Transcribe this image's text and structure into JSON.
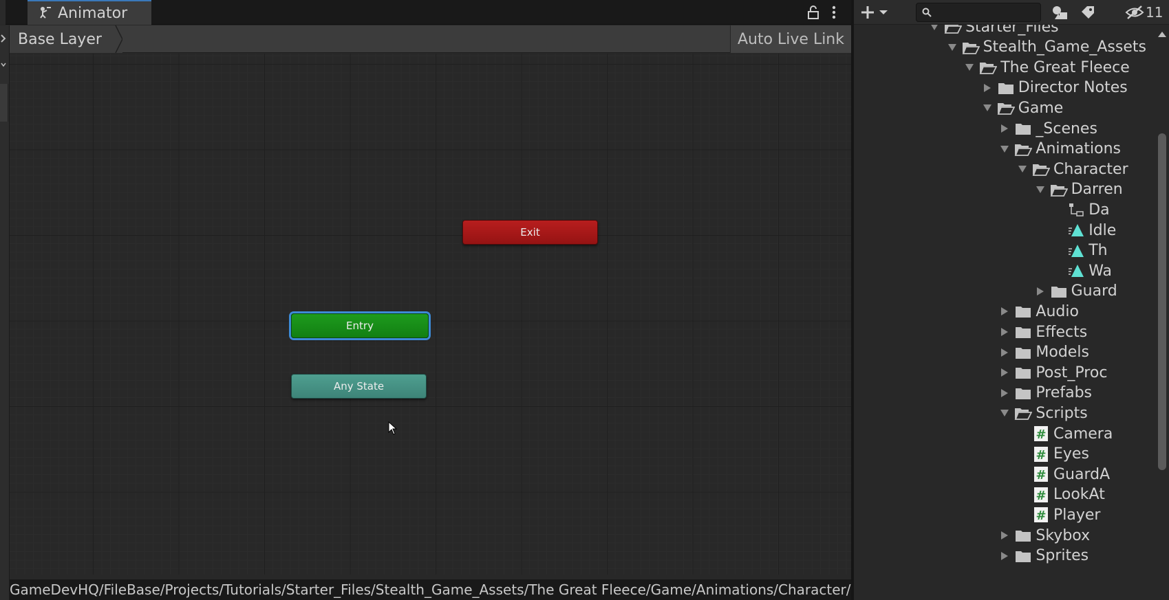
{
  "animator": {
    "tab_title": "Animator",
    "layer_name": "Base Layer",
    "live_link_label": "Auto Live Link",
    "states": {
      "exit": "Exit",
      "entry": "Entry",
      "any_state": "Any State"
    },
    "colors": {
      "exit": "#b81e1e",
      "entry": "#1e9b1e",
      "any_state": "#4f9f90",
      "selection": "#3d8ad6",
      "tab_accent": "#3a79bb"
    },
    "asset_path": "GameDevHQ/FileBase/Projects/Tutorials/Starter_Files/Stealth_Game_Assets/The Great Fleece/Game/Animations/Character/Da"
  },
  "project": {
    "search": {
      "value": "",
      "placeholder": ""
    },
    "hidden_packages_count": "11",
    "tree": [
      {
        "label": "Starter_Files",
        "depth": 0,
        "expanded": true,
        "icon": "folder-open-icon"
      },
      {
        "label": "Stealth_Game_Assets",
        "depth": 1,
        "expanded": true,
        "icon": "folder-open-icon"
      },
      {
        "label": "The Great Fleece",
        "depth": 2,
        "expanded": true,
        "icon": "folder-open-icon"
      },
      {
        "label": "Director Notes",
        "depth": 3,
        "expanded": false,
        "icon": "folder-icon"
      },
      {
        "label": "Game",
        "depth": 3,
        "expanded": true,
        "icon": "folder-open-icon"
      },
      {
        "label": "_Scenes",
        "depth": 4,
        "expanded": false,
        "icon": "folder-icon"
      },
      {
        "label": "Animations",
        "depth": 4,
        "expanded": true,
        "icon": "folder-open-icon"
      },
      {
        "label": "Character",
        "depth": 5,
        "expanded": true,
        "icon": "folder-open-icon"
      },
      {
        "label": "Darren",
        "depth": 6,
        "expanded": true,
        "icon": "folder-open-icon"
      },
      {
        "label": "Da",
        "depth": 7,
        "expanded": null,
        "icon": "animator-controller-icon"
      },
      {
        "label": "Idle",
        "depth": 7,
        "expanded": null,
        "icon": "animation-clip-icon"
      },
      {
        "label": "Th",
        "depth": 7,
        "expanded": null,
        "icon": "animation-clip-icon"
      },
      {
        "label": "Wa",
        "depth": 7,
        "expanded": null,
        "icon": "animation-clip-icon"
      },
      {
        "label": "Guard",
        "depth": 6,
        "expanded": false,
        "icon": "folder-icon"
      },
      {
        "label": "Audio",
        "depth": 4,
        "expanded": false,
        "icon": "folder-icon"
      },
      {
        "label": "Effects",
        "depth": 4,
        "expanded": false,
        "icon": "folder-icon"
      },
      {
        "label": "Models",
        "depth": 4,
        "expanded": false,
        "icon": "folder-icon"
      },
      {
        "label": "Post_Proc",
        "depth": 4,
        "expanded": false,
        "icon": "folder-icon"
      },
      {
        "label": "Prefabs",
        "depth": 4,
        "expanded": false,
        "icon": "folder-icon"
      },
      {
        "label": "Scripts",
        "depth": 4,
        "expanded": true,
        "icon": "folder-open-icon"
      },
      {
        "label": "Camera",
        "depth": 5,
        "expanded": null,
        "icon": "script-icon"
      },
      {
        "label": "Eyes",
        "depth": 5,
        "expanded": null,
        "icon": "script-icon"
      },
      {
        "label": "GuardA",
        "depth": 5,
        "expanded": null,
        "icon": "script-icon"
      },
      {
        "label": "LookAt",
        "depth": 5,
        "expanded": null,
        "icon": "script-icon"
      },
      {
        "label": "Player",
        "depth": 5,
        "expanded": null,
        "icon": "script-icon"
      },
      {
        "label": "Skybox",
        "depth": 4,
        "expanded": false,
        "icon": "folder-icon"
      },
      {
        "label": "Sprites",
        "depth": 4,
        "expanded": false,
        "icon": "folder-icon"
      }
    ]
  }
}
